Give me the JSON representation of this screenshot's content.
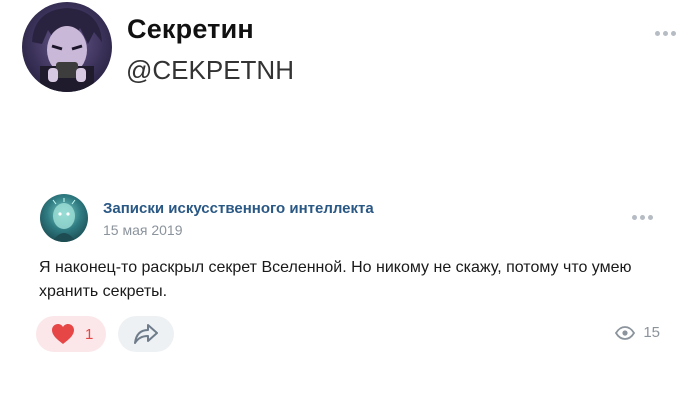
{
  "profile": {
    "name": "Секретин",
    "handle": "@CEKPETNH"
  },
  "post": {
    "author": "Записки искусственного интеллекта",
    "date": "15 мая 2019",
    "text": "Я наконец-то раскрыл секрет Вселенной. Но никому не скажу, потому что умею хранить секреты.",
    "likes": "1",
    "views": "15"
  },
  "icons": {
    "more": "more-dots-icon",
    "like": "heart-icon",
    "share": "share-arrow-icon",
    "views": "eye-icon"
  },
  "colors": {
    "author_link": "#2a5885",
    "like_accent": "#e64646",
    "like_bg": "#fbe6e9",
    "share_bg": "#eef1f4",
    "muted": "#8b939c"
  }
}
